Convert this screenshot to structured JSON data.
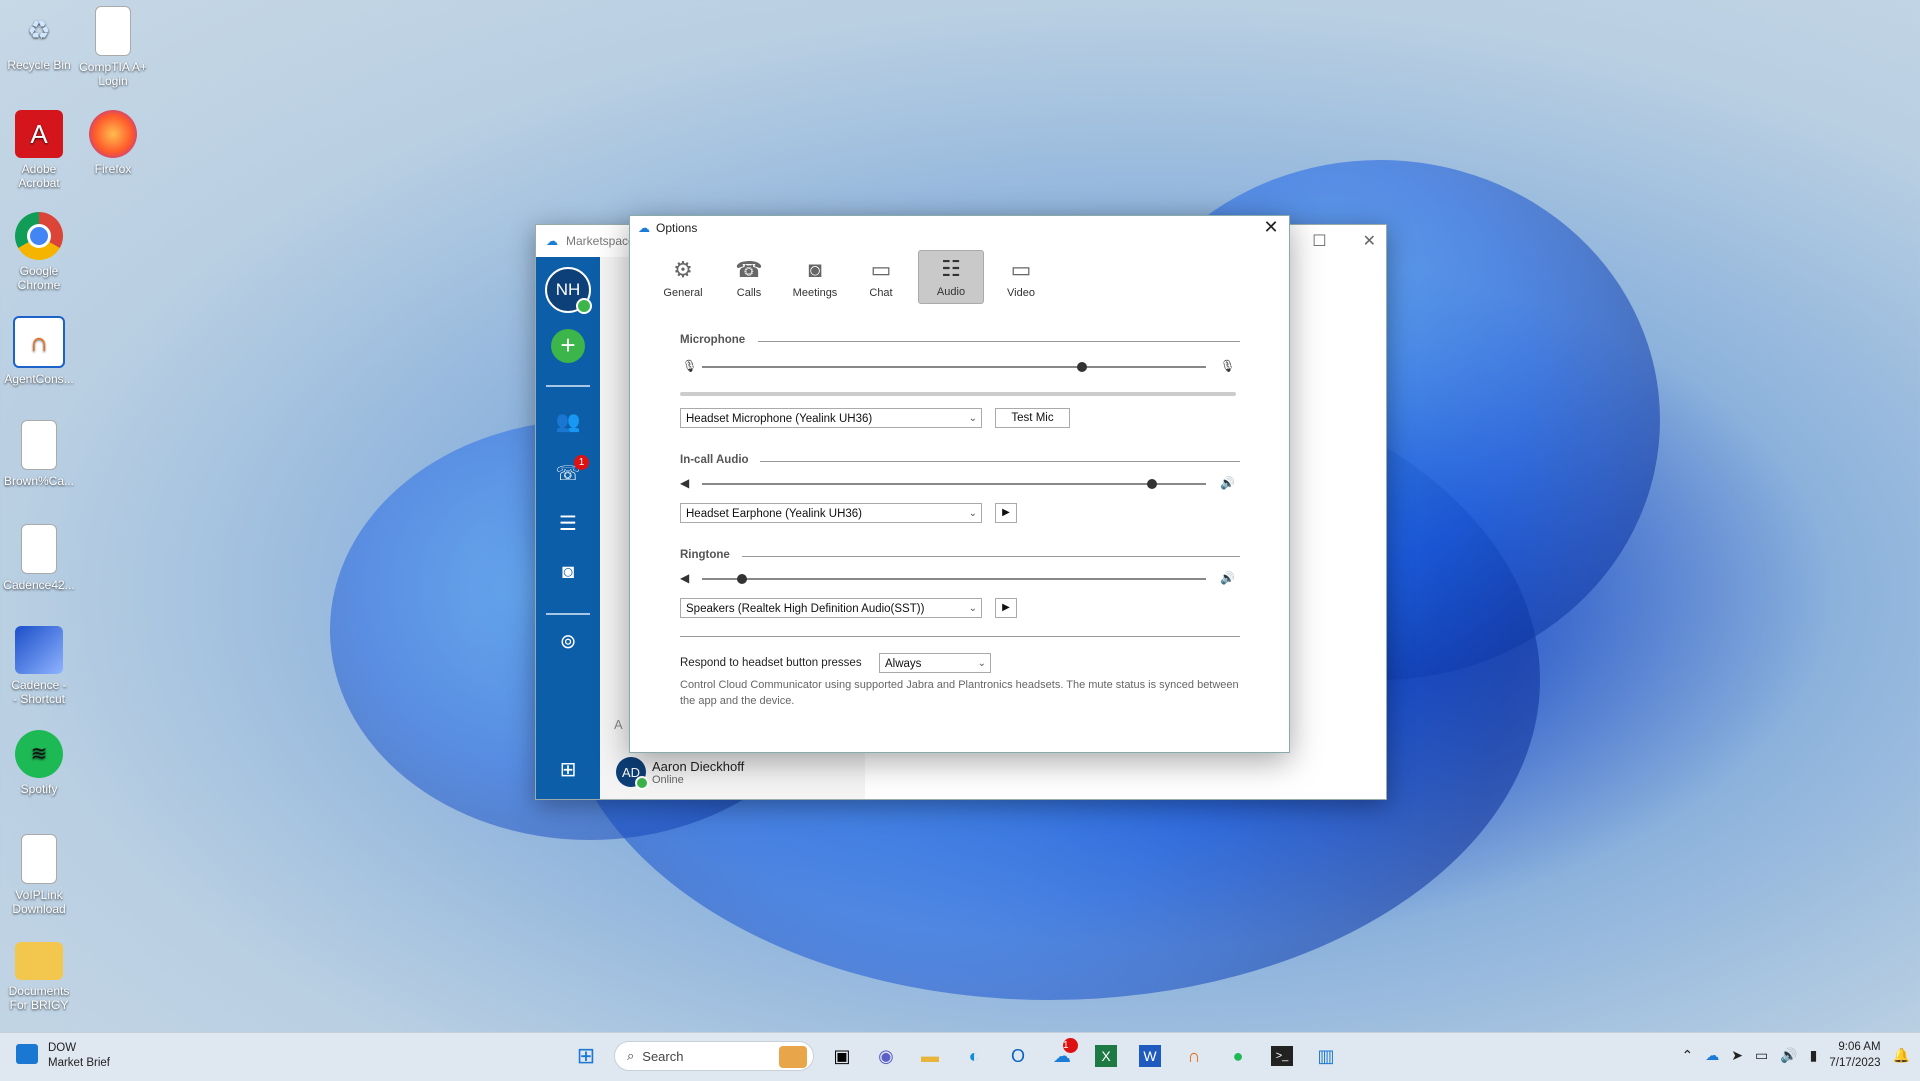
{
  "desktop": {
    "icons": [
      {
        "label": "Recycle Bin",
        "icon": "recycle-bin-icon"
      },
      {
        "label": "CompTIA A+\nLogin",
        "icon": "document-icon"
      },
      {
        "label": "Adobe\nAcrobat",
        "icon": "adobe-acrobat-icon"
      },
      {
        "label": "Firefox",
        "icon": "firefox-icon"
      },
      {
        "label": "Google\nChrome",
        "icon": "chrome-icon"
      },
      {
        "label": "AgentCons...",
        "icon": "agent-console-icon"
      },
      {
        "label": "Brown%Ca...",
        "icon": "document-icon"
      },
      {
        "label": "Cadence42...",
        "icon": "document-icon"
      },
      {
        "label": "Cadence -\n- Shortcut",
        "icon": "cadence-shortcut-icon"
      },
      {
        "label": "Spotify",
        "icon": "spotify-icon"
      },
      {
        "label": "VoIPLink\nDownload",
        "icon": "document-icon"
      },
      {
        "label": "Documents\nFor BRIGY",
        "icon": "folder-icon"
      }
    ]
  },
  "background_app": {
    "title": "Marketspace",
    "user_initials": "NH",
    "calls_badge": "1",
    "contact_group_letter": "A",
    "contact": {
      "initials": "AD",
      "name": "Aaron Dieckhoff",
      "status": "Online"
    }
  },
  "options_dialog": {
    "title": "Options",
    "tabs": [
      {
        "label": "General",
        "icon": "gear-icon",
        "active": false
      },
      {
        "label": "Calls",
        "icon": "phone-icon",
        "active": false
      },
      {
        "label": "Meetings",
        "icon": "meetings-icon",
        "active": false
      },
      {
        "label": "Chat",
        "icon": "chat-icon",
        "active": false
      },
      {
        "label": "Audio",
        "icon": "audio-sliders-icon",
        "active": true
      },
      {
        "label": "Video",
        "icon": "video-camera-icon",
        "active": false
      }
    ],
    "microphone": {
      "label": "Microphone",
      "level": 0.76,
      "device": "Headset Microphone (Yealink UH36)",
      "test_button": "Test Mic"
    },
    "in_call_audio": {
      "label": "In-call Audio",
      "level": 0.9,
      "device": "Headset Earphone (Yealink UH36)"
    },
    "ringtone": {
      "label": "Ringtone",
      "level": 0.08,
      "device": "Speakers (Realtek High Definition Audio(SST))"
    },
    "headset": {
      "label": "Respond to headset button presses",
      "value": "Always",
      "help": "Control Cloud Communicator using supported Jabra and Plantronics headsets. The mute status is synced between the app and the device."
    }
  },
  "taskbar": {
    "weather_title": "DOW",
    "weather_sub": "Market Brief",
    "search_placeholder": "Search",
    "notification_badge": "1",
    "time": "9:06 AM",
    "date": "7/17/2023"
  }
}
